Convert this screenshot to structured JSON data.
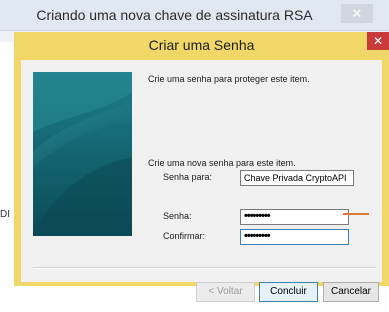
{
  "outer_window": {
    "title": "Criando uma nova chave de assinatura RSA",
    "close_glyph": "✕",
    "fragment_text": "DI"
  },
  "dialog": {
    "title": "Criar uma Senha",
    "close_glyph": "✕",
    "intro_text": "Crie uma senha para proteger este item.",
    "section_text": "Crie uma nova senha para este item.",
    "for_label": "Senha para:",
    "for_value": "Chave Privada CryptoAPI",
    "password_label": "Senha:",
    "password_value": "•••••••••",
    "confirm_label": "Confirmar:",
    "confirm_value": "•••••••••",
    "buttons": {
      "back": "< Voltar",
      "finish": "Concluir",
      "cancel": "Cancelar"
    }
  },
  "colors": {
    "dialog_frame": "#f0d768",
    "close_red": "#c93a3a",
    "side_panel": "#0f5d6a",
    "accent_focus": "#3c7fb1"
  }
}
